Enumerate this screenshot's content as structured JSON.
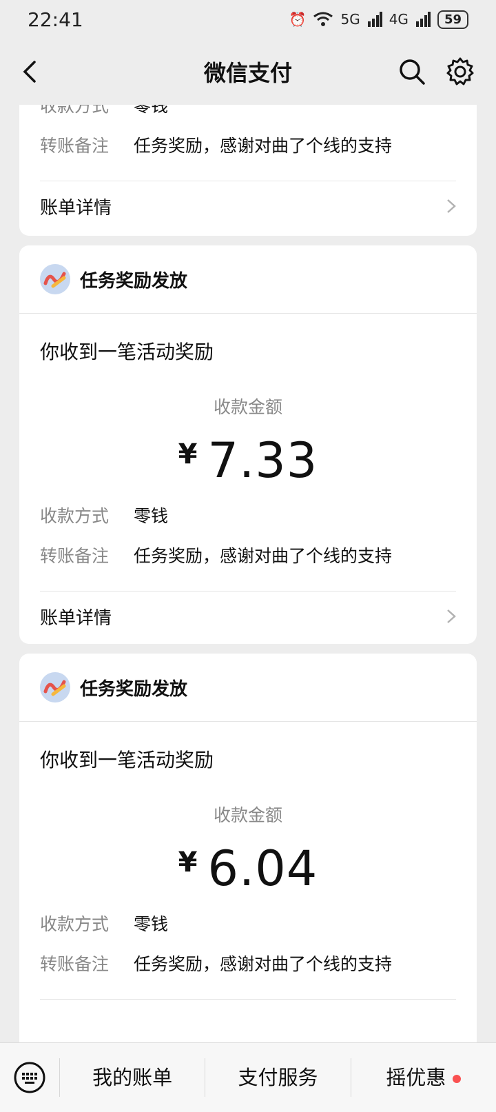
{
  "status_bar": {
    "time": "22:41",
    "network_1": "5G",
    "network_2": "4G",
    "battery": "59"
  },
  "nav": {
    "title": "微信支付"
  },
  "cards": [
    {
      "payment_label": "收款方式",
      "payment_value": "零钱",
      "note_label": "转账备注",
      "note_value": "任务奖励，感谢对曲了个线的支持",
      "detail_label": "账单详情"
    },
    {
      "app_name": "任务奖励发放",
      "subject": "你收到一笔活动奖励",
      "amount_label": "收款金额",
      "currency": "¥",
      "amount": "7.33",
      "payment_label": "收款方式",
      "payment_value": "零钱",
      "note_label": "转账备注",
      "note_value": "任务奖励，感谢对曲了个线的支持",
      "detail_label": "账单详情"
    },
    {
      "app_name": "任务奖励发放",
      "subject": "你收到一笔活动奖励",
      "amount_label": "收款金额",
      "currency": "¥",
      "amount": "6.04",
      "payment_label": "收款方式",
      "payment_value": "零钱",
      "note_label": "转账备注",
      "note_value": "任务奖励，感谢对曲了个线的支持"
    }
  ],
  "bottom_bar": {
    "tab_1": "我的账单",
    "tab_2": "支付服务",
    "tab_3": "摇优惠"
  },
  "colors": {
    "accent_red": "#fa5151",
    "secondary_text": "#888888"
  }
}
